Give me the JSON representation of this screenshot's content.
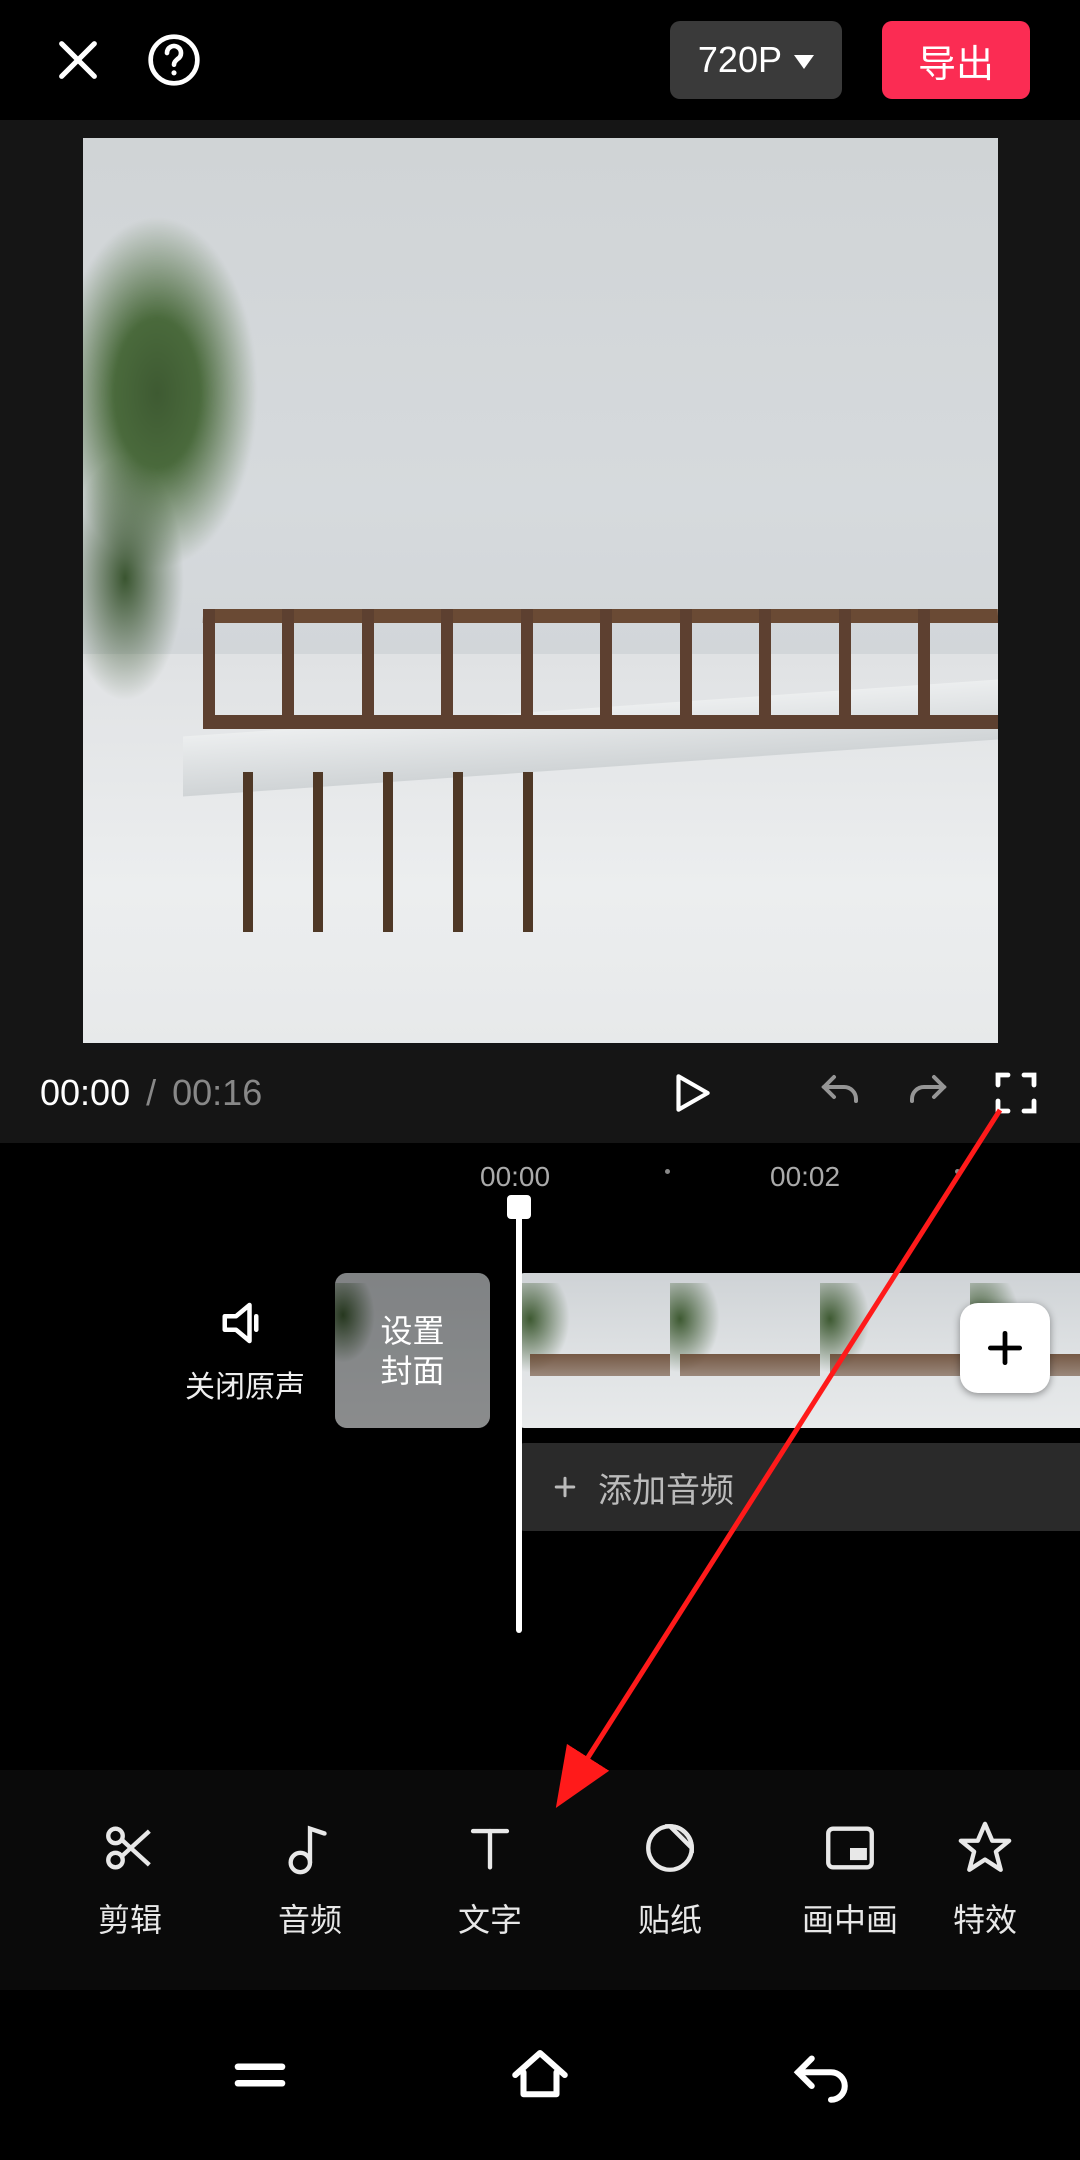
{
  "header": {
    "resolution_label": "720P",
    "export_label": "导出"
  },
  "playbar": {
    "current_time": "00:00",
    "separator": "/",
    "total_time": "00:16"
  },
  "ruler": {
    "tick0": "00:00",
    "tick1": "00:02"
  },
  "left_controls": {
    "mute_label": "关闭原声",
    "cover_label": "设置\n封面"
  },
  "audio_row": {
    "add_audio_label": "添加音频"
  },
  "toolbar": {
    "items": [
      {
        "label": "剪辑"
      },
      {
        "label": "音频"
      },
      {
        "label": "文字"
      },
      {
        "label": "贴纸"
      },
      {
        "label": "画中画"
      },
      {
        "label": "特效"
      }
    ]
  },
  "colors": {
    "accent": "#fb2c53",
    "bg": "#000000",
    "panel": "#151515"
  }
}
